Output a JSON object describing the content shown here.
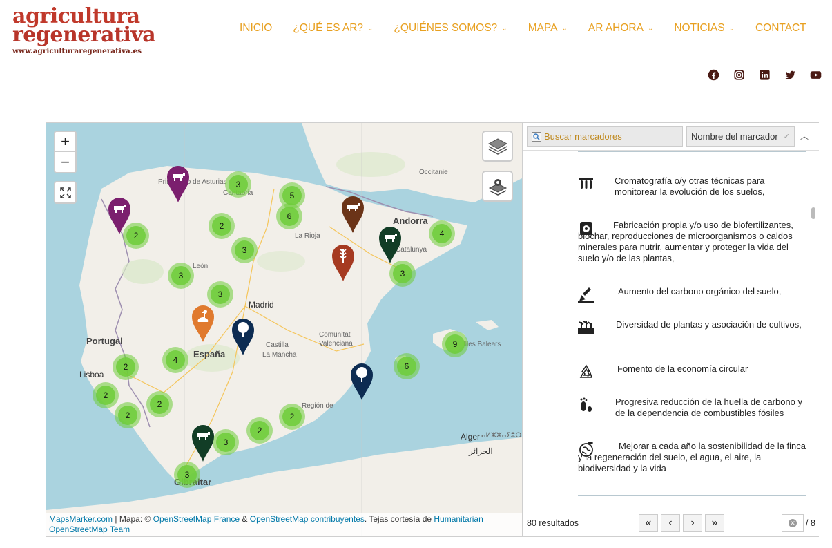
{
  "logo": {
    "line1": "agricultura",
    "line2": "regenerativa",
    "url": "www.agriculturaregenerativa.es"
  },
  "nav": [
    {
      "label": "INICIO",
      "dropdown": false
    },
    {
      "label": "¿QUÉ ES AR?",
      "dropdown": true
    },
    {
      "label": "¿QUIÉNES SOMOS?",
      "dropdown": true
    },
    {
      "label": "MAPA",
      "dropdown": true
    },
    {
      "label": "AR AHORA",
      "dropdown": true
    },
    {
      "label": "NOTICIAS",
      "dropdown": true
    },
    {
      "label": "CONTACT",
      "dropdown": false
    }
  ],
  "colors": {
    "nav": "#e8a020",
    "cluster": "#6ecc39",
    "sea": "#aad3df",
    "land": "#f2efe9",
    "link": "#0078a8"
  },
  "social": [
    "facebook-icon",
    "instagram-icon",
    "linkedin-icon",
    "twitter-icon",
    "youtube-icon"
  ],
  "map": {
    "zoom_in": "+",
    "zoom_out": "−",
    "places": {
      "portugal": "Portugal",
      "espana": "España",
      "madrid": "Madrid",
      "lisboa": "Lisboa",
      "andorra": "Andorra",
      "gibraltar": "Gibraltar",
      "alger": "Alger",
      "alger_ar": "الجزائر",
      "alger_ber": "ⴰⵍⵣⵣⴰⵢⴻⵔ",
      "occitanie": "Occitanie",
      "catalunya": "Catalunya",
      "leon": "León",
      "rioja": "La Rioja",
      "castilla": "Castilla",
      "mancha": "La Mancha",
      "comunitat": "Comunitat",
      "valenciana": "Valenciana",
      "murcia": "Región de",
      "cantabria": "Cantabria",
      "asturias": "Principado de Asturias",
      "baleares": "Illes Balears"
    },
    "clusters": [
      {
        "count": "3"
      },
      {
        "count": "5"
      },
      {
        "count": "6"
      },
      {
        "count": "2"
      },
      {
        "count": "3"
      },
      {
        "count": "2"
      },
      {
        "count": "3"
      },
      {
        "count": "3"
      },
      {
        "count": "4"
      },
      {
        "count": "3"
      },
      {
        "count": "9"
      },
      {
        "count": "6"
      },
      {
        "count": "2"
      },
      {
        "count": "4"
      },
      {
        "count": "2"
      },
      {
        "count": "2"
      },
      {
        "count": "2"
      },
      {
        "count": "2"
      },
      {
        "count": "2"
      },
      {
        "count": "3"
      },
      {
        "count": "3"
      }
    ],
    "pins": [
      {
        "icon": "cow-icon",
        "color": "#7b1f6e"
      },
      {
        "icon": "cow-icon",
        "color": "#7b1f6e"
      },
      {
        "icon": "cow-icon",
        "color": "#6b3418"
      },
      {
        "icon": "cow-icon",
        "color": "#123d26"
      },
      {
        "icon": "wheat-icon",
        "color": "#a63a21"
      },
      {
        "icon": "goose-icon",
        "color": "#e07a2e"
      },
      {
        "icon": "tree-icon",
        "color": "#0d2c52"
      },
      {
        "icon": "tree-icon",
        "color": "#0d2c52"
      },
      {
        "icon": "cow-icon",
        "color": "#123d26"
      }
    ],
    "attribution": {
      "mapsmarker": "MapsMarker.com",
      "sep1": " | Mapa: © ",
      "osm_france": "OpenStreetMap France",
      "amp": " & ",
      "osm_contrib": "OpenStreetMap contribuyentes",
      "tiles": ". Tejas cortesía de ",
      "humanitarian": "Humanitarian",
      "team": "OpenStreetMap Team"
    }
  },
  "panel": {
    "search_placeholder": "Buscar marcadores",
    "sort_label": "Nombre del marcador",
    "items": [
      {
        "icon": "test-tubes-icon",
        "text": "Cromatografía o/y otras técnicas para monitorear la evolución de los suelos,"
      },
      {
        "icon": "fertilizer-bag-icon",
        "text": "Fabricación propia y/o uso de biofertilizantes, biochar, reproducciones de microorganismos o caldos minerales para nutrir, aumentar y proteger la vida del suelo y/o de las plantas,"
      },
      {
        "icon": "shovel-icon",
        "text": "Aumento del carbono orgánico del suelo,"
      },
      {
        "icon": "plants-icon",
        "text": "Diversidad de plantas y asociación de cultivos,"
      },
      {
        "icon": "recycle-icon",
        "text": "Fomento de la economía circular"
      },
      {
        "icon": "footprint-icon",
        "text": "Progresiva reducción de la huella de carbono y de la dependencia de combustibles fósiles"
      },
      {
        "icon": "earth-leaf-icon",
        "text": "Mejorar a cada año la sostenibilidad de la finca y la regeneración del suelo, el agua, el aire, la biodiversidad y la vida"
      }
    ],
    "results": "80 resultados",
    "pager": {
      "first": "«",
      "prev": "‹",
      "next": "›",
      "last": "»"
    },
    "page_total": "/ 8"
  }
}
